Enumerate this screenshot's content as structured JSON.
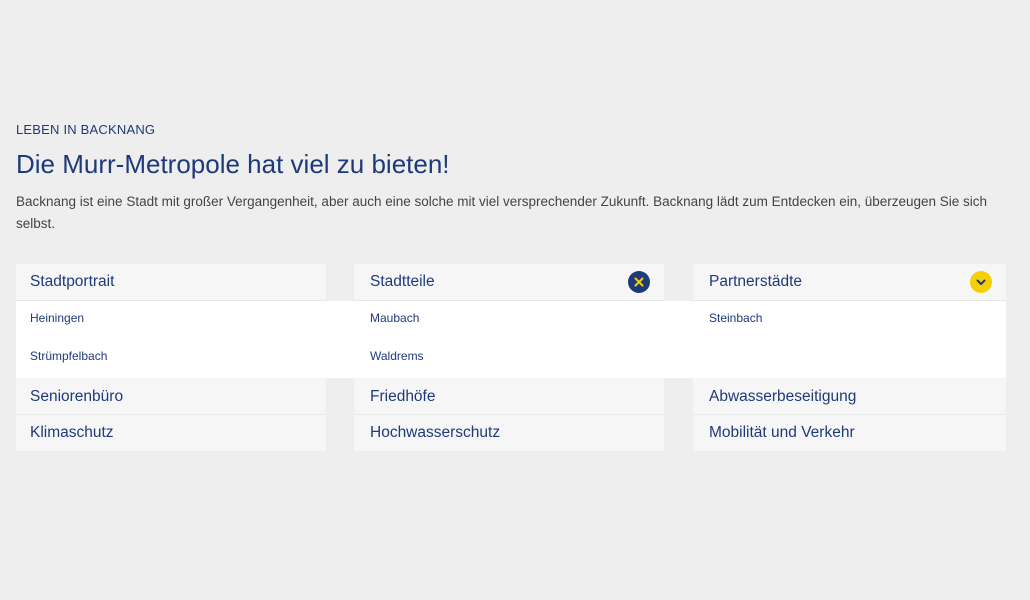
{
  "intro": {
    "eyebrow": "LEBEN IN BACKNANG",
    "headline": "Die Murr-Metropole hat viel zu bieten!",
    "lead": "Backnang ist eine Stadt mit großer Vergangenheit, aber auch eine solche mit viel versprechender Zukunft. Backnang lädt zum Entdecken ein, überzeugen Sie sich selbst."
  },
  "accordion": {
    "col1": {
      "title": "Stadtportrait",
      "items": [
        "Heiningen",
        "Strümpfelbach"
      ]
    },
    "col2": {
      "title": "Stadtteile",
      "items": [
        "Maubach",
        "Waldrems"
      ],
      "icon": "close-icon"
    },
    "col3": {
      "title": "Partnerstädte",
      "items": [
        "Steinbach"
      ],
      "icon": "chevron-down-icon"
    },
    "row2": [
      "Seniorenbüro",
      "Friedhöfe",
      "Abwasserbeseitigung"
    ],
    "row3": [
      "Klimaschutz",
      "Hochwasserschutz",
      "Mobilität und Verkehr"
    ]
  },
  "colors": {
    "brand": "#1f3a7a",
    "accent": "#f5d000",
    "background": "#eeeeee"
  }
}
